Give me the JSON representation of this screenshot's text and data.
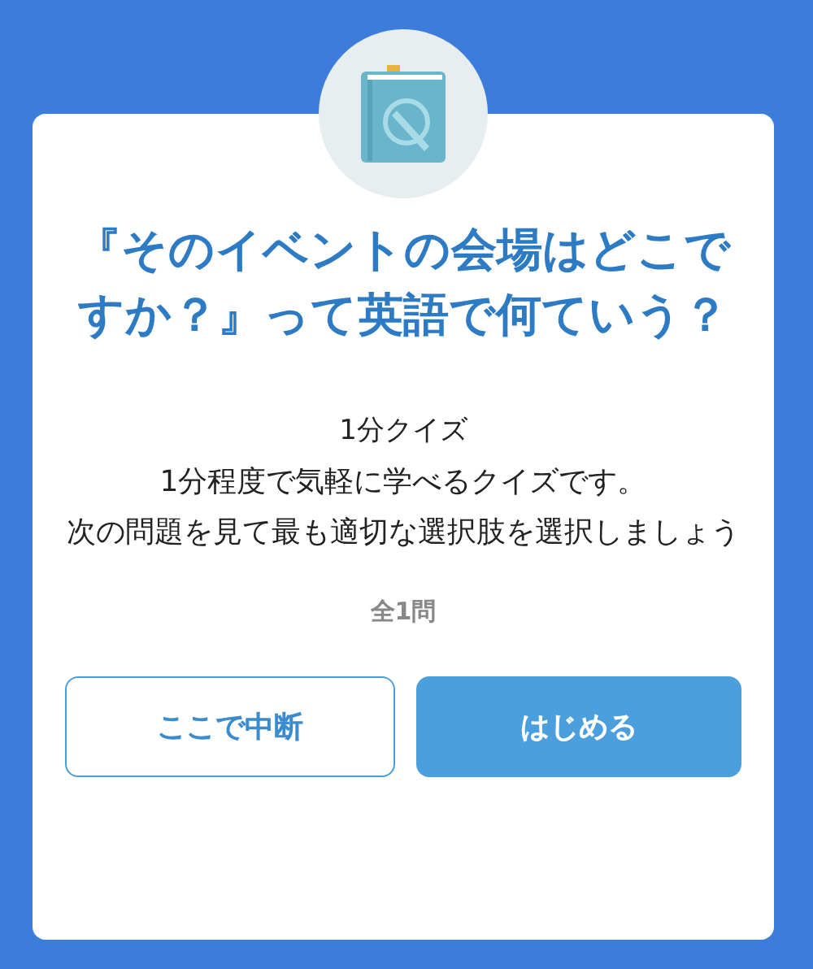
{
  "dialog": {
    "title": "『そのイベントの会場はどこですか？』って英語で何ていう？",
    "quiz_name": "1分クイズ",
    "description": [
      "1分程度で気軽に学べるクイズです。",
      "次の問題を見て最も適切な選択肢を選択しましょう"
    ],
    "question_count": "全1問",
    "buttons": [
      {
        "label": "ここで中断",
        "kind": "secondary"
      },
      {
        "label": "はじめる",
        "kind": "primary"
      }
    ]
  }
}
